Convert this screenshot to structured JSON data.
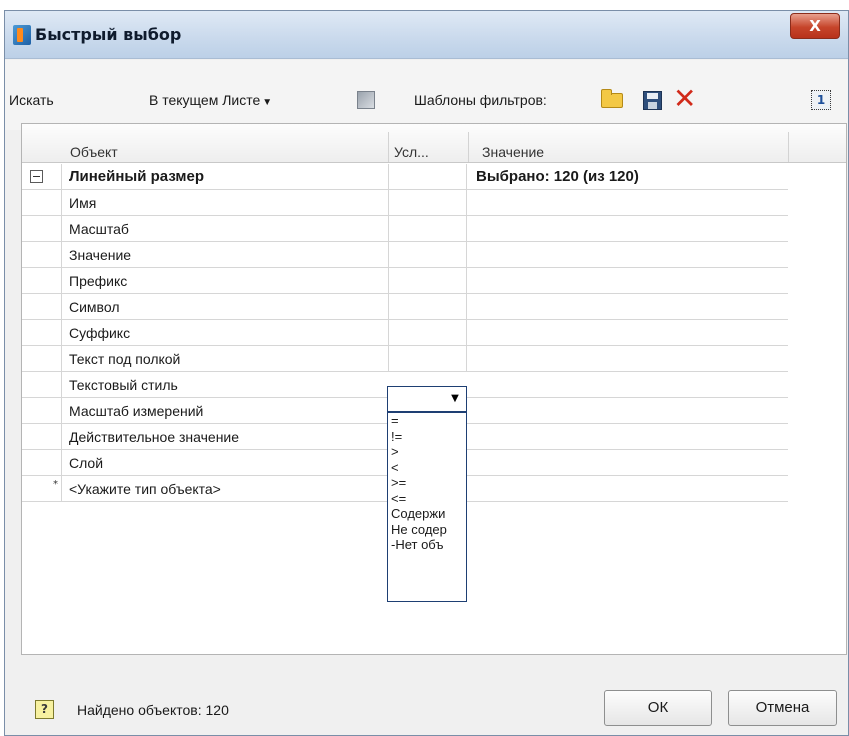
{
  "window": {
    "title": "Быстрый выбор",
    "close_label": "X"
  },
  "toolbar": {
    "search_label": "Искать",
    "scope_value": "В текущем Листе",
    "filter_templates_label": "Шаблоны фильтров:",
    "delete_glyph": "✕",
    "select_one_glyph": "1"
  },
  "grid": {
    "headers": {
      "object": "Объект",
      "condition": "Усл...",
      "value": "Значение"
    },
    "group": {
      "label": "Линейный размер",
      "value": "Выбрано: 120 (из 120)"
    },
    "rows": [
      "Имя",
      "Масштаб",
      "Значение",
      "Префикс",
      "Символ",
      "Суффикс",
      "Текст под полкой",
      "Текстовый стиль",
      "Масштаб измерений",
      "Действительное значение",
      "Слой"
    ],
    "new_row": {
      "marker": "*",
      "placeholder": "<Укажите тип объекта>"
    }
  },
  "condition_dropdown": {
    "options": [
      "=",
      "!=",
      ">",
      "<",
      ">=",
      "<=",
      "Содержи",
      "Не содер",
      "-Нет объ"
    ]
  },
  "status": {
    "found_text": "Найдено объектов: 120",
    "help_glyph": "?"
  },
  "buttons": {
    "ok": "ОК",
    "cancel": "Отмена"
  }
}
